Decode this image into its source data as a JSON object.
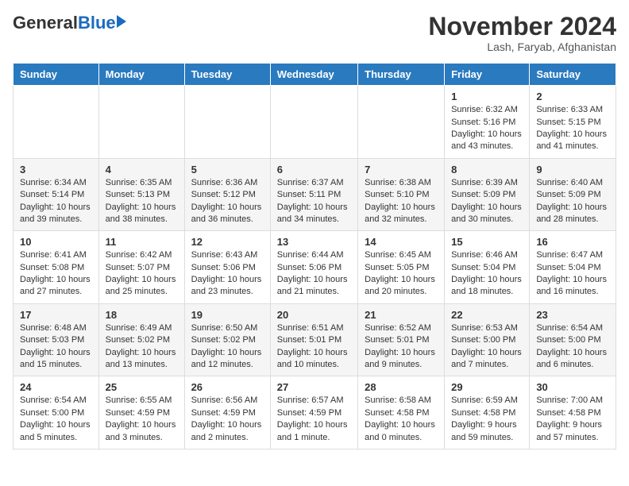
{
  "header": {
    "logo_general": "General",
    "logo_blue": "Blue",
    "title": "November 2024",
    "subtitle": "Lash, Faryab, Afghanistan"
  },
  "calendar": {
    "columns": [
      "Sunday",
      "Monday",
      "Tuesday",
      "Wednesday",
      "Thursday",
      "Friday",
      "Saturday"
    ],
    "weeks": [
      [
        {
          "day": "",
          "info": ""
        },
        {
          "day": "",
          "info": ""
        },
        {
          "day": "",
          "info": ""
        },
        {
          "day": "",
          "info": ""
        },
        {
          "day": "",
          "info": ""
        },
        {
          "day": "1",
          "info": "Sunrise: 6:32 AM\nSunset: 5:16 PM\nDaylight: 10 hours and 43 minutes."
        },
        {
          "day": "2",
          "info": "Sunrise: 6:33 AM\nSunset: 5:15 PM\nDaylight: 10 hours and 41 minutes."
        }
      ],
      [
        {
          "day": "3",
          "info": "Sunrise: 6:34 AM\nSunset: 5:14 PM\nDaylight: 10 hours and 39 minutes."
        },
        {
          "day": "4",
          "info": "Sunrise: 6:35 AM\nSunset: 5:13 PM\nDaylight: 10 hours and 38 minutes."
        },
        {
          "day": "5",
          "info": "Sunrise: 6:36 AM\nSunset: 5:12 PM\nDaylight: 10 hours and 36 minutes."
        },
        {
          "day": "6",
          "info": "Sunrise: 6:37 AM\nSunset: 5:11 PM\nDaylight: 10 hours and 34 minutes."
        },
        {
          "day": "7",
          "info": "Sunrise: 6:38 AM\nSunset: 5:10 PM\nDaylight: 10 hours and 32 minutes."
        },
        {
          "day": "8",
          "info": "Sunrise: 6:39 AM\nSunset: 5:09 PM\nDaylight: 10 hours and 30 minutes."
        },
        {
          "day": "9",
          "info": "Sunrise: 6:40 AM\nSunset: 5:09 PM\nDaylight: 10 hours and 28 minutes."
        }
      ],
      [
        {
          "day": "10",
          "info": "Sunrise: 6:41 AM\nSunset: 5:08 PM\nDaylight: 10 hours and 27 minutes."
        },
        {
          "day": "11",
          "info": "Sunrise: 6:42 AM\nSunset: 5:07 PM\nDaylight: 10 hours and 25 minutes."
        },
        {
          "day": "12",
          "info": "Sunrise: 6:43 AM\nSunset: 5:06 PM\nDaylight: 10 hours and 23 minutes."
        },
        {
          "day": "13",
          "info": "Sunrise: 6:44 AM\nSunset: 5:06 PM\nDaylight: 10 hours and 21 minutes."
        },
        {
          "day": "14",
          "info": "Sunrise: 6:45 AM\nSunset: 5:05 PM\nDaylight: 10 hours and 20 minutes."
        },
        {
          "day": "15",
          "info": "Sunrise: 6:46 AM\nSunset: 5:04 PM\nDaylight: 10 hours and 18 minutes."
        },
        {
          "day": "16",
          "info": "Sunrise: 6:47 AM\nSunset: 5:04 PM\nDaylight: 10 hours and 16 minutes."
        }
      ],
      [
        {
          "day": "17",
          "info": "Sunrise: 6:48 AM\nSunset: 5:03 PM\nDaylight: 10 hours and 15 minutes."
        },
        {
          "day": "18",
          "info": "Sunrise: 6:49 AM\nSunset: 5:02 PM\nDaylight: 10 hours and 13 minutes."
        },
        {
          "day": "19",
          "info": "Sunrise: 6:50 AM\nSunset: 5:02 PM\nDaylight: 10 hours and 12 minutes."
        },
        {
          "day": "20",
          "info": "Sunrise: 6:51 AM\nSunset: 5:01 PM\nDaylight: 10 hours and 10 minutes."
        },
        {
          "day": "21",
          "info": "Sunrise: 6:52 AM\nSunset: 5:01 PM\nDaylight: 10 hours and 9 minutes."
        },
        {
          "day": "22",
          "info": "Sunrise: 6:53 AM\nSunset: 5:00 PM\nDaylight: 10 hours and 7 minutes."
        },
        {
          "day": "23",
          "info": "Sunrise: 6:54 AM\nSunset: 5:00 PM\nDaylight: 10 hours and 6 minutes."
        }
      ],
      [
        {
          "day": "24",
          "info": "Sunrise: 6:54 AM\nSunset: 5:00 PM\nDaylight: 10 hours and 5 minutes."
        },
        {
          "day": "25",
          "info": "Sunrise: 6:55 AM\nSunset: 4:59 PM\nDaylight: 10 hours and 3 minutes."
        },
        {
          "day": "26",
          "info": "Sunrise: 6:56 AM\nSunset: 4:59 PM\nDaylight: 10 hours and 2 minutes."
        },
        {
          "day": "27",
          "info": "Sunrise: 6:57 AM\nSunset: 4:59 PM\nDaylight: 10 hours and 1 minute."
        },
        {
          "day": "28",
          "info": "Sunrise: 6:58 AM\nSunset: 4:58 PM\nDaylight: 10 hours and 0 minutes."
        },
        {
          "day": "29",
          "info": "Sunrise: 6:59 AM\nSunset: 4:58 PM\nDaylight: 9 hours and 59 minutes."
        },
        {
          "day": "30",
          "info": "Sunrise: 7:00 AM\nSunset: 4:58 PM\nDaylight: 9 hours and 57 minutes."
        }
      ]
    ]
  }
}
